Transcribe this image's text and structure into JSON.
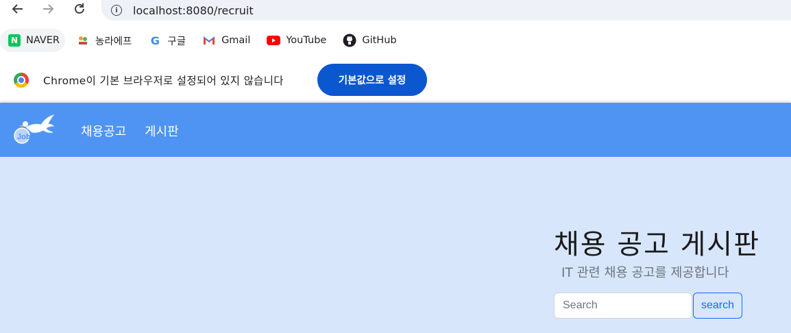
{
  "browser": {
    "url": "localhost:8080/recruit",
    "bookmarks": [
      {
        "label": "NAVER",
        "icon": "naver-icon"
      },
      {
        "label": "농라에프",
        "icon": "nongra-icon"
      },
      {
        "label": "구글",
        "icon": "google-icon"
      },
      {
        "label": "Gmail",
        "icon": "gmail-icon"
      },
      {
        "label": "YouTube",
        "icon": "youtube-icon"
      },
      {
        "label": "GitHub",
        "icon": "github-icon"
      }
    ],
    "infobar": {
      "message": "Chrome이 기본 브라우저로 설정되어 있지 않습니다",
      "button_label": "기본값으로 설정"
    }
  },
  "site": {
    "nav": {
      "links": [
        "채용공고",
        "게시판"
      ]
    },
    "hero": {
      "title": "채용 공고 게시판",
      "subtitle": "IT 관련 채용 공고를 제공합니다",
      "search_placeholder": "Search",
      "search_button": "search"
    }
  },
  "colors": {
    "navbar": "#4f94f3",
    "hero_bg": "#d8e6fc",
    "chrome_button": "#0b57d0",
    "primary": "#0d6efd"
  }
}
